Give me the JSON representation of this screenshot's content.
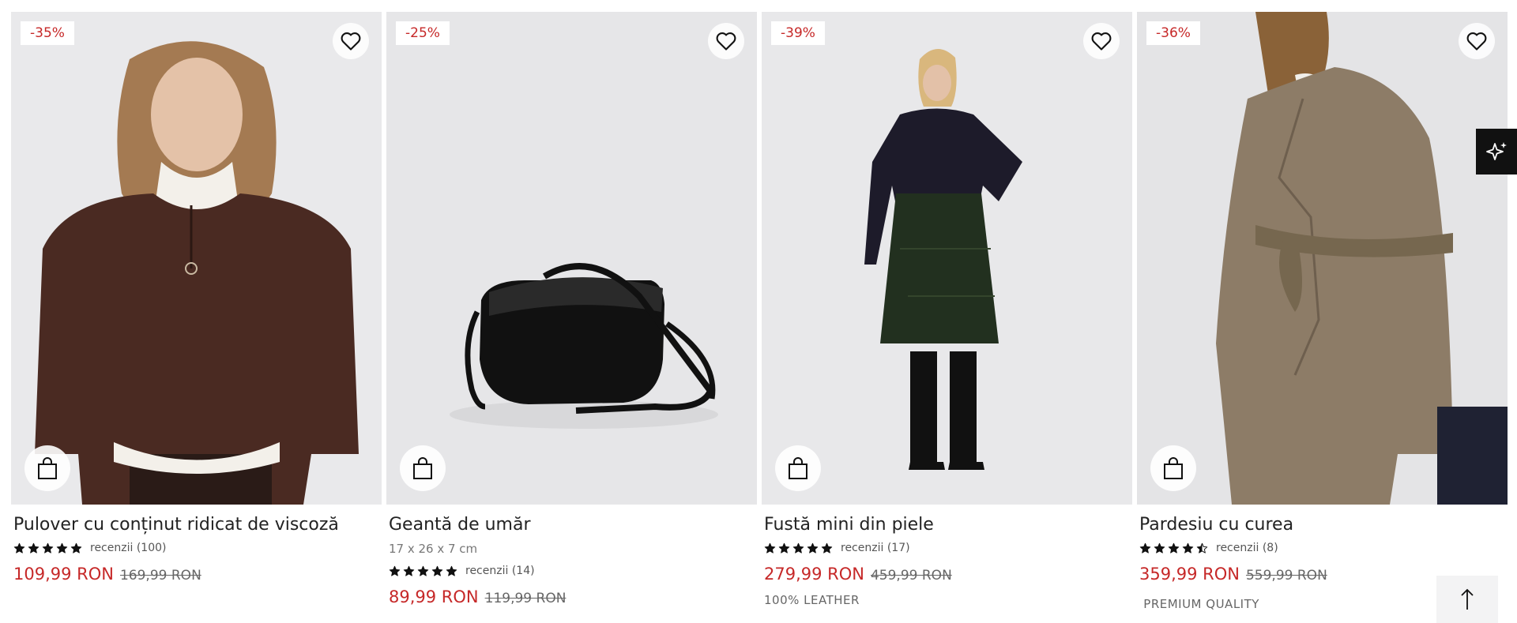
{
  "products": [
    {
      "discount": "-35%",
      "title": "Pulover cu conținut ridicat de viscoză",
      "rating": 5,
      "reviews": "recenzii (100)",
      "price_new": "109,99 RON",
      "price_old": "169,99 RON",
      "favorite_icon": "heart-outline-icon",
      "cart_icon": "shopping-bag-icon"
    },
    {
      "discount": "-25%",
      "title": "Geantă de umăr",
      "dimensions": "17 x 26 x 7 cm",
      "rating": 5,
      "reviews": "recenzii (14)",
      "price_new": "89,99 RON",
      "price_old": "119,99 RON",
      "favorite_icon": "heart-outline-icon",
      "cart_icon": "shopping-bag-icon"
    },
    {
      "discount": "-39%",
      "title": "Fustă mini din piele",
      "rating": 5,
      "reviews": "recenzii (17)",
      "price_new": "279,99 RON",
      "price_old": "459,99 RON",
      "tag": "100% LEATHER",
      "favorite_icon": "heart-outline-icon",
      "cart_icon": "shopping-bag-icon"
    },
    {
      "discount": "-36%",
      "title": "Pardesiu cu curea",
      "rating": 4.5,
      "reviews": "recenzii (8)",
      "price_new": "359,99 RON",
      "price_old": "559,99 RON",
      "tag": " PREMIUM QUALITY",
      "favorite_icon": "heart-outline-icon",
      "cart_icon": "shopping-bag-icon"
    }
  ],
  "floating": {
    "assistant_icon": "sparkles-icon",
    "scroll_top_icon": "arrow-up-icon"
  },
  "colors": {
    "sale_red": "#c62828",
    "text": "#222222",
    "muted": "#777777",
    "image_bg": "#e8e8ea"
  }
}
